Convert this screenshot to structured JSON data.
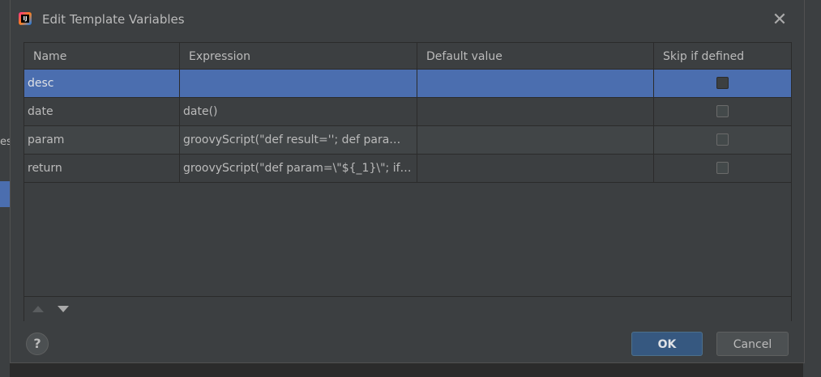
{
  "background": {
    "left_fragment_text": "es"
  },
  "dialog": {
    "title": "Edit Template Variables",
    "app_icon_text": "IJ",
    "close_glyph": "✕"
  },
  "table": {
    "columns": [
      "Name",
      "Expression",
      "Default value",
      "Skip if defined"
    ],
    "rows": [
      {
        "name": "desc",
        "expression": "",
        "default_value": "",
        "skip_if_defined": false,
        "selected": true
      },
      {
        "name": "date",
        "expression": "date()",
        "default_value": "",
        "skip_if_defined": false,
        "selected": false
      },
      {
        "name": "param",
        "expression": "groovyScript(\"def result=''; def para…",
        "default_value": "",
        "skip_if_defined": false,
        "selected": false
      },
      {
        "name": "return",
        "expression": "groovyScript(\"def param=\\\"${_1}\\\"; if…",
        "default_value": "",
        "skip_if_defined": false,
        "selected": false
      }
    ]
  },
  "toolbar": {
    "move_up_icon": "triangle-up-icon",
    "move_down_icon": "triangle-down-icon"
  },
  "footer": {
    "help_label": "?",
    "ok_label": "OK",
    "cancel_label": "Cancel"
  },
  "colors": {
    "selection": "#4b6eaf",
    "dialog_bg": "#3c3f41",
    "ok_button": "#365880"
  }
}
